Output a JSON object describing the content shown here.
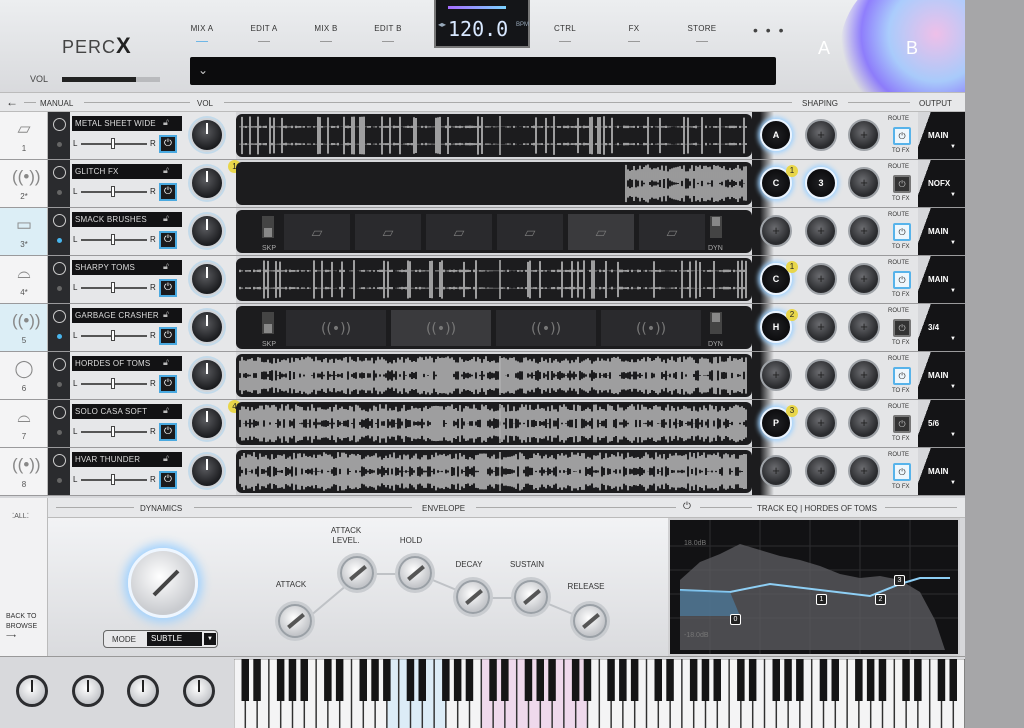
{
  "header": {
    "logo_text": "PERC",
    "logo_x": "X",
    "vol_label": "VOL",
    "vol_level": 0.76,
    "nav": [
      "MIX A",
      "EDIT A",
      "MIX B",
      "EDIT B",
      "CTRL",
      "FX",
      "STORE"
    ],
    "active_nav": "MIX A",
    "tempo": "120.0",
    "tempo_unit": "BPM",
    "more": "• • •",
    "program": "",
    "program_icon": "chevron-down",
    "a": "A",
    "b": "B"
  },
  "section": {
    "manual": "MANUAL",
    "vol": "VOL",
    "shaping": "SHAPING",
    "output": "OUTPUT"
  },
  "tracks": [
    {
      "num": "1",
      "name": "METAL SHEET WIDE",
      "icon": "sheet-icon",
      "marker": "",
      "shaping": [
        "A",
        "",
        ""
      ],
      "shaping_markers": [
        "",
        "",
        ""
      ],
      "route_on": true,
      "output": "MAIN"
    },
    {
      "num": "2*",
      "name": "GLITCH FX",
      "icon": "vibration-icon",
      "marker": "1",
      "shaping": [
        "C",
        "3",
        ""
      ],
      "shaping_markers": [
        "1",
        "",
        ""
      ],
      "route_on": false,
      "output": "NOFX"
    },
    {
      "num": "3*",
      "name": "SMACK BRUSHES",
      "icon": "brushes-icon",
      "marker": "",
      "shaping": [
        "",
        "",
        ""
      ],
      "shaping_markers": [
        "",
        "",
        ""
      ],
      "route_on": true,
      "output": "MAIN"
    },
    {
      "num": "4*",
      "name": "SHARPY TOMS",
      "icon": "drums-icon",
      "marker": "",
      "shaping": [
        "C",
        "",
        ""
      ],
      "shaping_markers": [
        "1",
        "",
        ""
      ],
      "route_on": true,
      "output": "MAIN"
    },
    {
      "num": "5",
      "name": "GARBAGE CRASHER",
      "icon": "vibration-icon",
      "marker": "",
      "shaping": [
        "H",
        "",
        ""
      ],
      "shaping_markers": [
        "2",
        "",
        ""
      ],
      "route_on": false,
      "output": "3/4"
    },
    {
      "num": "6",
      "name": "HORDES OF TOMS",
      "icon": "drum-icon",
      "marker": "",
      "shaping": [
        "",
        "",
        ""
      ],
      "shaping_markers": [
        "",
        "",
        ""
      ],
      "route_on": true,
      "output": "MAIN"
    },
    {
      "num": "7",
      "name": "SOLO CASA SOFT",
      "icon": "drums-icon",
      "marker": "4",
      "shaping": [
        "P",
        "",
        ""
      ],
      "shaping_markers": [
        "3",
        "",
        ""
      ],
      "route_on": false,
      "output": "5/6"
    },
    {
      "num": "8",
      "name": "HVAR THUNDER",
      "icon": "vibration-icon",
      "marker": "",
      "shaping": [
        "",
        "",
        ""
      ],
      "shaping_markers": [
        "",
        "",
        ""
      ],
      "route_on": true,
      "output": "MAIN"
    }
  ],
  "track_labels": {
    "l": "L",
    "r": "R",
    "route": "ROUTE",
    "to_fx": "TO FX",
    "skp": "SKP",
    "dyn": "DYN"
  },
  "bottom": {
    "dynamics": "DYNAMICS",
    "envelope": "ENVELOPE",
    "track_eq": "TRACK EQ | HORDES OF TOMS",
    "all": "ALL",
    "back_to_browse": "BACK TO\nBROWSE",
    "mode_label": "MODE",
    "mode_value": "SUBTLE",
    "env": [
      "ATTACK",
      "ATTACK LEVEL.",
      "HOLD",
      "DECAY",
      "SUSTAIN",
      "RELEASE"
    ],
    "eq_top": "18.0dB",
    "eq_bottom": "-18.0dB",
    "eq_nodes": [
      "0",
      "1",
      "2",
      "3"
    ]
  },
  "colors": {
    "accent": "#4aa9e0",
    "marker": "#e8d64a",
    "dark": "#1c1c1e"
  }
}
